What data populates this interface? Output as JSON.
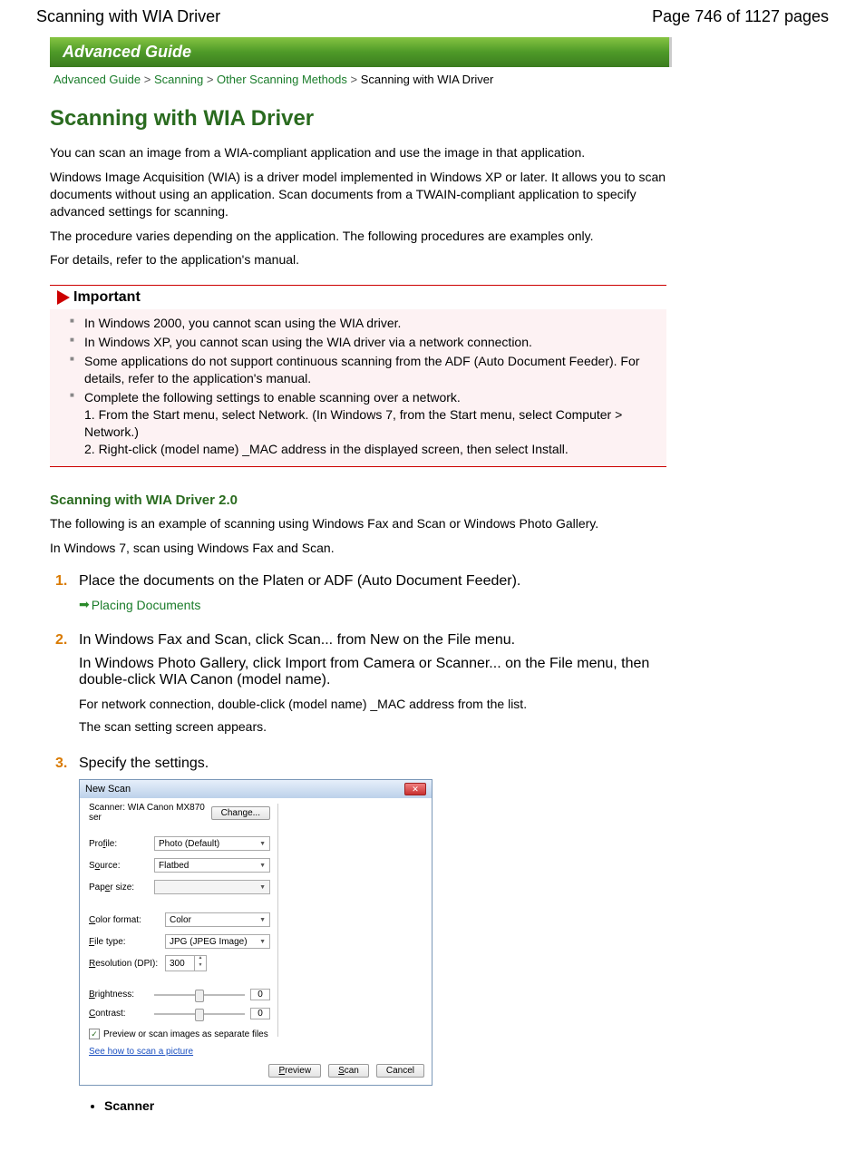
{
  "header": {
    "title_left": "Scanning with WIA Driver",
    "page_label": "Page 746 of 1127 pages"
  },
  "banner": "Advanced Guide",
  "breadcrumb": {
    "items": [
      "Advanced Guide",
      "Scanning",
      "Other Scanning Methods"
    ],
    "current": "Scanning with WIA Driver",
    "sep": " > "
  },
  "title": "Scanning with WIA Driver",
  "intro": [
    "You can scan an image from a WIA-compliant application and use the image in that application.",
    "Windows Image Acquisition (WIA) is a driver model implemented in Windows XP or later. It allows you to scan documents without using an application. Scan documents from a TWAIN-compliant application to specify advanced settings for scanning.",
    "The procedure varies depending on the application. The following procedures are examples only.",
    "For details, refer to the application's manual."
  ],
  "important": {
    "label": "Important",
    "items": [
      "In Windows 2000, you cannot scan using the WIA driver.",
      "In Windows XP, you cannot scan using the WIA driver via a network connection.",
      "Some applications do not support continuous scanning from the ADF (Auto Document Feeder). For details, refer to the application's manual.",
      "Complete the following settings to enable scanning over a network.\n1. From the Start menu, select Network. (In Windows 7, from the Start menu, select Computer > Network.)\n2. Right-click (model name) _MAC address in the displayed screen, then select Install."
    ]
  },
  "sub": {
    "heading": "Scanning with WIA Driver 2.0",
    "p1": "The following is an example of scanning using Windows Fax and Scan or Windows Photo Gallery.",
    "p2": "In Windows 7, scan using Windows Fax and Scan."
  },
  "steps": {
    "s1": {
      "head": "Place the documents on the Platen or ADF (Auto Document Feeder).",
      "link": "Placing Documents"
    },
    "s2": {
      "head": "In Windows Fax and Scan, click Scan... from New on the File menu.",
      "p1": "In Windows Photo Gallery, click Import from Camera or Scanner... on the File menu, then double-click WIA Canon (model name).",
      "p2": "For network connection, double-click (model name) _MAC address from the list.",
      "p3": "The scan setting screen appears."
    },
    "s3": {
      "head": "Specify the settings."
    }
  },
  "dialog": {
    "title": "New Scan",
    "scanner_label": "Scanner: WIA Canon MX870 ser",
    "change": "Change...",
    "profile_label": "Profile:",
    "profile_value": "Photo (Default)",
    "source_label": "Source:",
    "source_value": "Flatbed",
    "paper_label": "Paper size:",
    "paper_value": "",
    "color_label": "Color format:",
    "color_value": "Color",
    "file_label": "File type:",
    "file_value": "JPG (JPEG Image)",
    "res_label": "Resolution (DPI):",
    "res_value": "300",
    "bright_label": "Brightness:",
    "bright_value": "0",
    "contrast_label": "Contrast:",
    "contrast_value": "0",
    "checkbox": "Preview or scan images as separate files",
    "help": "See how to scan a picture",
    "preview_btn": "Preview",
    "scan_btn": "Scan",
    "cancel_btn": "Cancel"
  },
  "term": "Scanner"
}
